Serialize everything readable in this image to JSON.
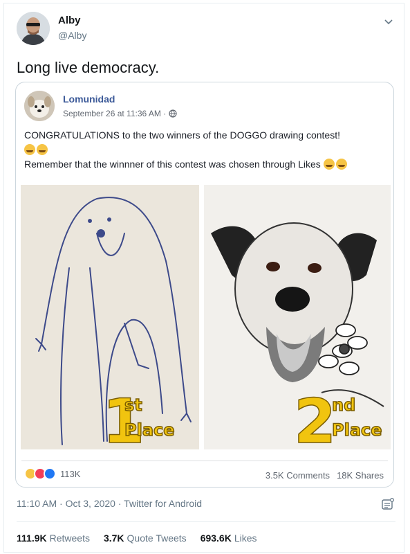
{
  "author": {
    "display_name": "Alby",
    "handle": "@Alby"
  },
  "tweet_text": "Long live democracy.",
  "embedded_post": {
    "page_name": "Lomunidad",
    "date": "September 26 at 11:36 AM ·",
    "line1": "CONGRATULATIONS to the two winners of the DOGGO drawing contest!",
    "line2": "Remember that the winnner of this contest was chosen through Likes",
    "left_image": {
      "place_number": "1",
      "place_suffix": "st",
      "place_word": "Place"
    },
    "right_image": {
      "place_number": "2",
      "place_suffix": "nd",
      "place_word": "Place"
    },
    "reaction_count": "113K",
    "comments": "3.5K Comments",
    "shares": "18K Shares"
  },
  "meta": {
    "time": "11:10 AM",
    "date": "Oct 3, 2020",
    "source": "Twitter for Android",
    "separator": "·"
  },
  "counts": {
    "retweets_value": "111.9K",
    "retweets_label": "Retweets",
    "quotes_value": "3.7K",
    "quotes_label": "Quote Tweets",
    "likes_value": "693.6K",
    "likes_label": "Likes"
  },
  "colors": {
    "fb_blue": "#3b5998",
    "twitter_gray": "#657786",
    "gold": "#f1c40f"
  }
}
